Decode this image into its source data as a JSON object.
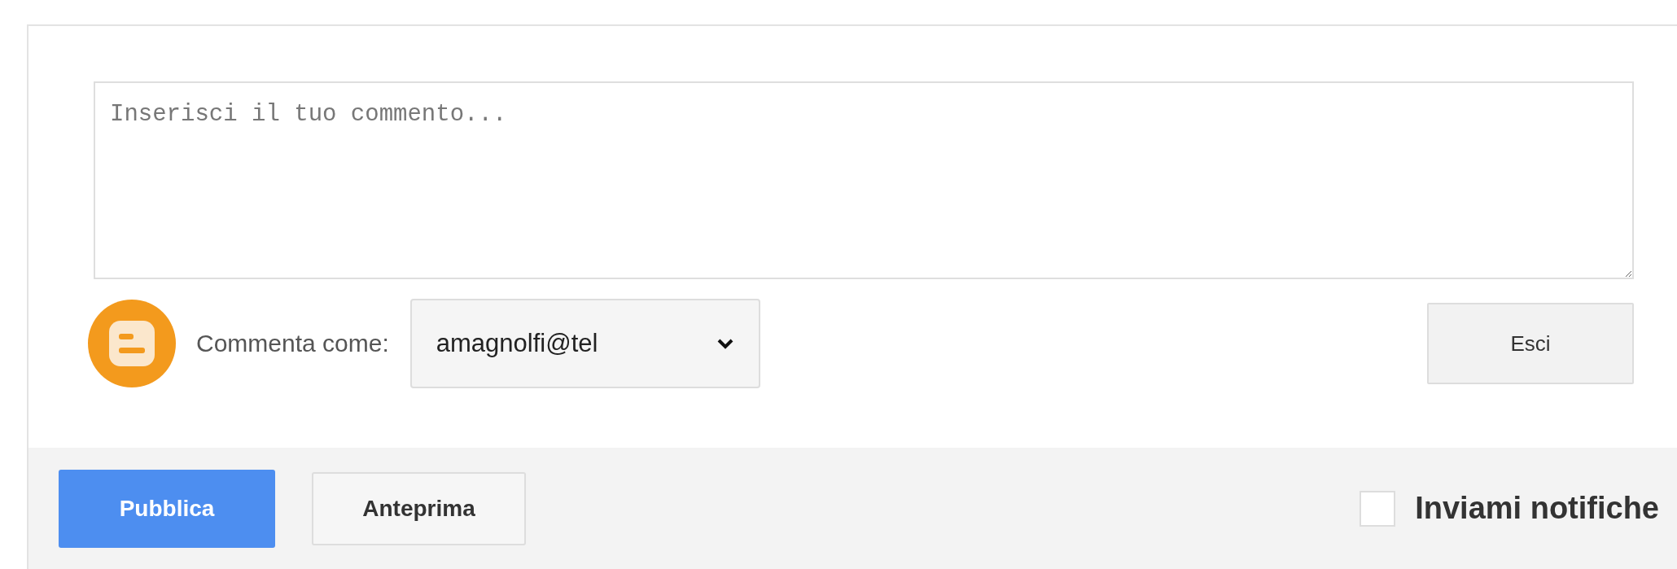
{
  "comment": {
    "placeholder": "Inserisci il tuo commento..."
  },
  "identity": {
    "label": "Commenta come:",
    "account": "amagnolfi@tel"
  },
  "sign_out_button": "Esci",
  "actions": [
    {
      "label": "Pubblica",
      "kind": "primary"
    },
    {
      "label": "Anteprima",
      "kind": "secondary"
    }
  ],
  "notify": {
    "label": "Inviami notifiche",
    "checked": false
  }
}
